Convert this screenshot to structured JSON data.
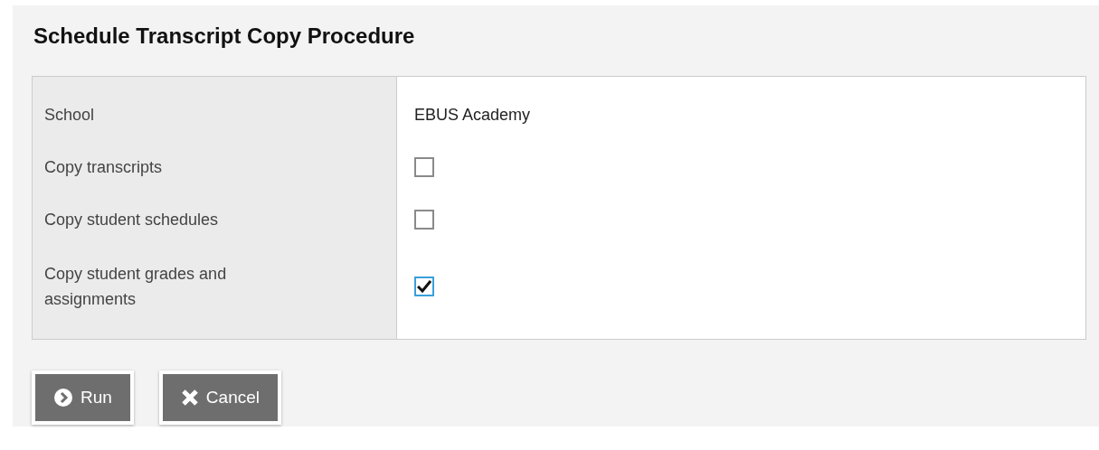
{
  "title": "Schedule Transcript Copy Procedure",
  "fields": [
    {
      "kind": "text",
      "label": "School",
      "value": "EBUS Academy"
    },
    {
      "kind": "checkbox",
      "label": "Copy transcripts",
      "checked": false
    },
    {
      "kind": "checkbox",
      "label": "Copy student schedules",
      "checked": false
    },
    {
      "kind": "checkbox",
      "label": "Copy student grades and assignments",
      "checked": true
    }
  ],
  "buttons": [
    {
      "kind": "run",
      "label": "Run"
    },
    {
      "kind": "cancel",
      "label": "Cancel"
    }
  ]
}
